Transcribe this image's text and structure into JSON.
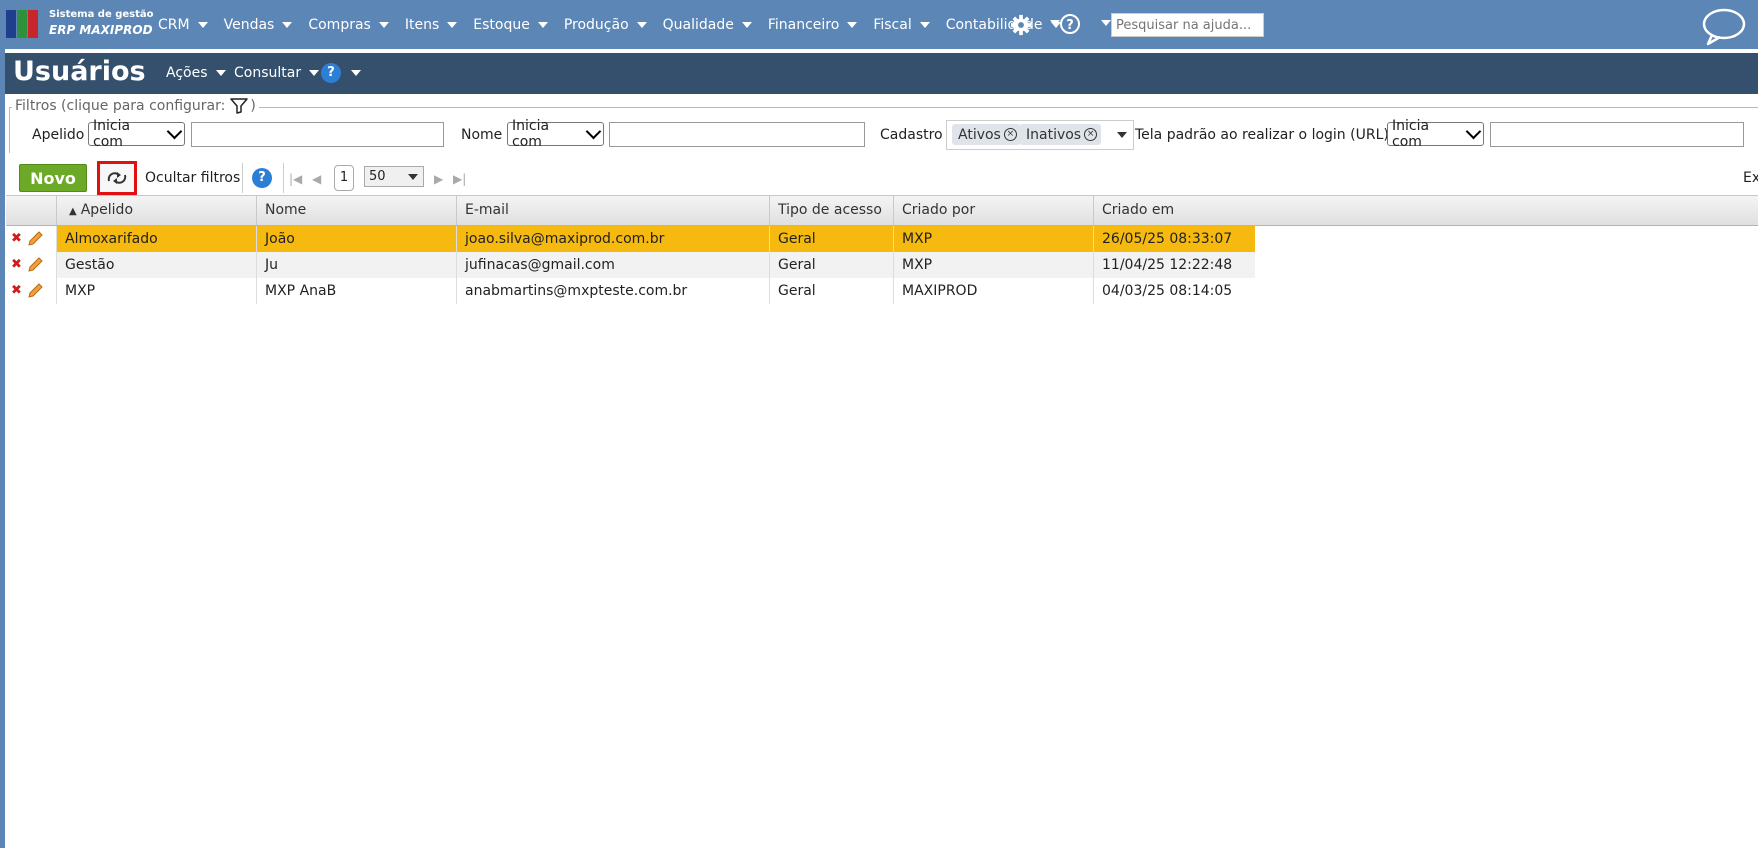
{
  "app": {
    "logo_line1": "Sistema de gestão",
    "logo_line2": "ERP MAXIPROD"
  },
  "menu": [
    {
      "label": "CRM"
    },
    {
      "label": "Vendas"
    },
    {
      "label": "Compras"
    },
    {
      "label": "Itens"
    },
    {
      "label": "Estoque"
    },
    {
      "label": "Produção"
    },
    {
      "label": "Qualidade"
    },
    {
      "label": "Financeiro"
    },
    {
      "label": "Fiscal"
    },
    {
      "label": "Contabilidade"
    }
  ],
  "help": {
    "glyph": "?"
  },
  "search": {
    "placeholder": "Pesquisar na ajuda..."
  },
  "page": {
    "title": "Usuários",
    "menu_acoes": "Ações",
    "menu_consultar": "Consultar",
    "help_glyph": "?"
  },
  "filters": {
    "legend": "Filtros (clique para configurar:",
    "legend_close": ")",
    "apelido_label": "Apelido",
    "apelido_mode": "Inicia com",
    "nome_label": "Nome",
    "nome_mode": "Inicia com",
    "cadastro_label": "Cadastro",
    "cadastro_tags": [
      "Ativos",
      "Inativos"
    ],
    "tela_label": "Tela padrão ao realizar o login (URL)",
    "tela_mode": "Inicia com"
  },
  "toolbar": {
    "novo": "Novo",
    "ocultar_filtros": "Ocultar filtros",
    "help_glyph": "?",
    "page_number": "1",
    "page_size": "50",
    "exibir_partial": "Exi"
  },
  "table": {
    "sort_indicator": "▲",
    "columns": [
      "Apelido",
      "Nome",
      "E-mail",
      "Tipo de acesso",
      "Criado por",
      "Criado em"
    ],
    "rows": [
      {
        "apelido": "Almoxarifado",
        "nome": "João",
        "email": "joao.silva@maxiprod.com.br",
        "tipo": "Geral",
        "criado_por": "MXP",
        "criado_em": "26/05/25 08:33:07",
        "selected": true
      },
      {
        "apelido": "Gestão",
        "nome": "Ju",
        "email": "jufinacas@gmail.com",
        "tipo": "Geral",
        "criado_por": "MXP",
        "criado_em": "11/04/25 12:22:48",
        "selected": false
      },
      {
        "apelido": "MXP",
        "nome": "MXP AnaB",
        "email": "anabmartins@mxpteste.com.br",
        "tipo": "Geral",
        "criado_por": "MAXIPROD",
        "criado_em": "04/03/25 08:14:05",
        "selected": false
      }
    ]
  },
  "colors": {
    "topbar": "#5b86b6",
    "titlebar": "#34506d",
    "selected_row": "#f5b90f",
    "alt_row": "#f2f2f2",
    "novo_button": "#6ca926",
    "highlight_box": "#e01010"
  },
  "icons": {
    "gear": "gear-icon",
    "help": "help-circle-icon",
    "chat": "chat-bubble-icon",
    "filter": "filter-funnel-icon",
    "refresh": "refresh-icon",
    "delete": "delete-x-icon",
    "edit": "pencil-icon"
  }
}
